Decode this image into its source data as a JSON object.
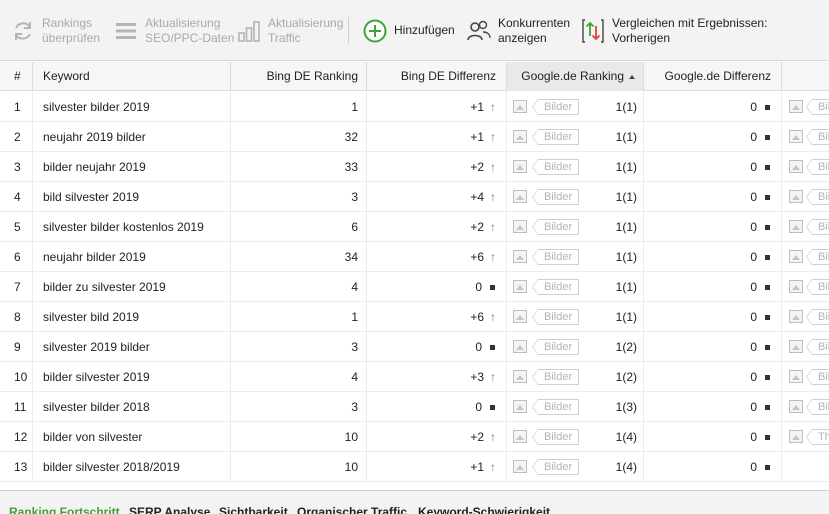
{
  "toolbar": {
    "check_rankings": {
      "label": "Rankings\nüberprüfen",
      "line1": "Rankings",
      "line2": "überprüfen"
    },
    "update_seo": {
      "line1": "Aktualisierung",
      "line2": "SEO/PPC-Daten"
    },
    "update_traffic": {
      "line1": "Aktualisierung",
      "line2": "Traffic"
    },
    "add": {
      "label": "Hinzufügen"
    },
    "competitors": {
      "line1": "Konkurrenten",
      "line2": "anzeigen"
    },
    "compare": {
      "line1": "Vergleichen mit Ergebnissen:",
      "line2": "Vorherigen"
    }
  },
  "colors": {
    "accent": "#3fa33b",
    "down": "#e2432f"
  },
  "table": {
    "headers": {
      "num": "#",
      "keyword": "Keyword",
      "bing_rank": "Bing DE Ranking",
      "bing_diff": "Bing DE Differenz",
      "google_rank": "Google.de Ranking",
      "google_diff": "Google.de Differenz"
    },
    "tag_label": "Bilder",
    "rows": [
      {
        "n": "1",
        "keyword": "silvester bilder 2019",
        "bing": "1",
        "bing_diff": "+1",
        "bing_trend": "up",
        "google": "1(1)",
        "google_diff": "0",
        "extra": "Bil"
      },
      {
        "n": "2",
        "keyword": "neujahr 2019 bilder",
        "bing": "32",
        "bing_diff": "+1",
        "bing_trend": "up",
        "google": "1(1)",
        "google_diff": "0",
        "extra": "Bil"
      },
      {
        "n": "3",
        "keyword": "bilder neujahr 2019",
        "bing": "33",
        "bing_diff": "+2",
        "bing_trend": "up",
        "google": "1(1)",
        "google_diff": "0",
        "extra": "Bil"
      },
      {
        "n": "4",
        "keyword": "bild silvester 2019",
        "bing": "3",
        "bing_diff": "+4",
        "bing_trend": "up",
        "google": "1(1)",
        "google_diff": "0",
        "extra": "Bil"
      },
      {
        "n": "5",
        "keyword": "silvester bilder kostenlos 2019",
        "bing": "6",
        "bing_diff": "+2",
        "bing_trend": "up",
        "google": "1(1)",
        "google_diff": "0",
        "extra": "Bil"
      },
      {
        "n": "6",
        "keyword": "neujahr bilder 2019",
        "bing": "34",
        "bing_diff": "+6",
        "bing_trend": "up",
        "google": "1(1)",
        "google_diff": "0",
        "extra": "Bil"
      },
      {
        "n": "7",
        "keyword": "bilder zu silvester 2019",
        "bing": "4",
        "bing_diff": "0",
        "bing_trend": "same",
        "google": "1(1)",
        "google_diff": "0",
        "extra": "Bil"
      },
      {
        "n": "8",
        "keyword": "silvester bild 2019",
        "bing": "1",
        "bing_diff": "+6",
        "bing_trend": "up",
        "google": "1(1)",
        "google_diff": "0",
        "extra": "Bil"
      },
      {
        "n": "9",
        "keyword": "silvester 2019 bilder",
        "bing": "3",
        "bing_diff": "0",
        "bing_trend": "same",
        "google": "1(2)",
        "google_diff": "0",
        "extra": "Bil"
      },
      {
        "n": "10",
        "keyword": "bilder silvester 2019",
        "bing": "4",
        "bing_diff": "+3",
        "bing_trend": "up",
        "google": "1(2)",
        "google_diff": "0",
        "extra": "Bil"
      },
      {
        "n": "11",
        "keyword": "silvester bilder 2018",
        "bing": "3",
        "bing_diff": "0",
        "bing_trend": "same",
        "google": "1(3)",
        "google_diff": "0",
        "extra": "Bil"
      },
      {
        "n": "12",
        "keyword": "bilder von silvester",
        "bing": "10",
        "bing_diff": "+2",
        "bing_trend": "up",
        "google": "1(4)",
        "google_diff": "0",
        "extra": "Th"
      },
      {
        "n": "13",
        "keyword": "bilder silvester 2018/2019",
        "bing": "10",
        "bing_diff": "+1",
        "bing_trend": "up",
        "google": "1(4)",
        "google_diff": "0",
        "extra": ""
      }
    ]
  },
  "tabs": [
    {
      "label": "Ranking Fortschritt",
      "active": true
    },
    {
      "label": "SERP Analyse",
      "active": false
    },
    {
      "label": "Sichtbarkeit",
      "active": false
    },
    {
      "label": "Organischer Traffic",
      "active": false
    },
    {
      "label": "Keyword-Schwierigkeit",
      "active": false
    }
  ]
}
